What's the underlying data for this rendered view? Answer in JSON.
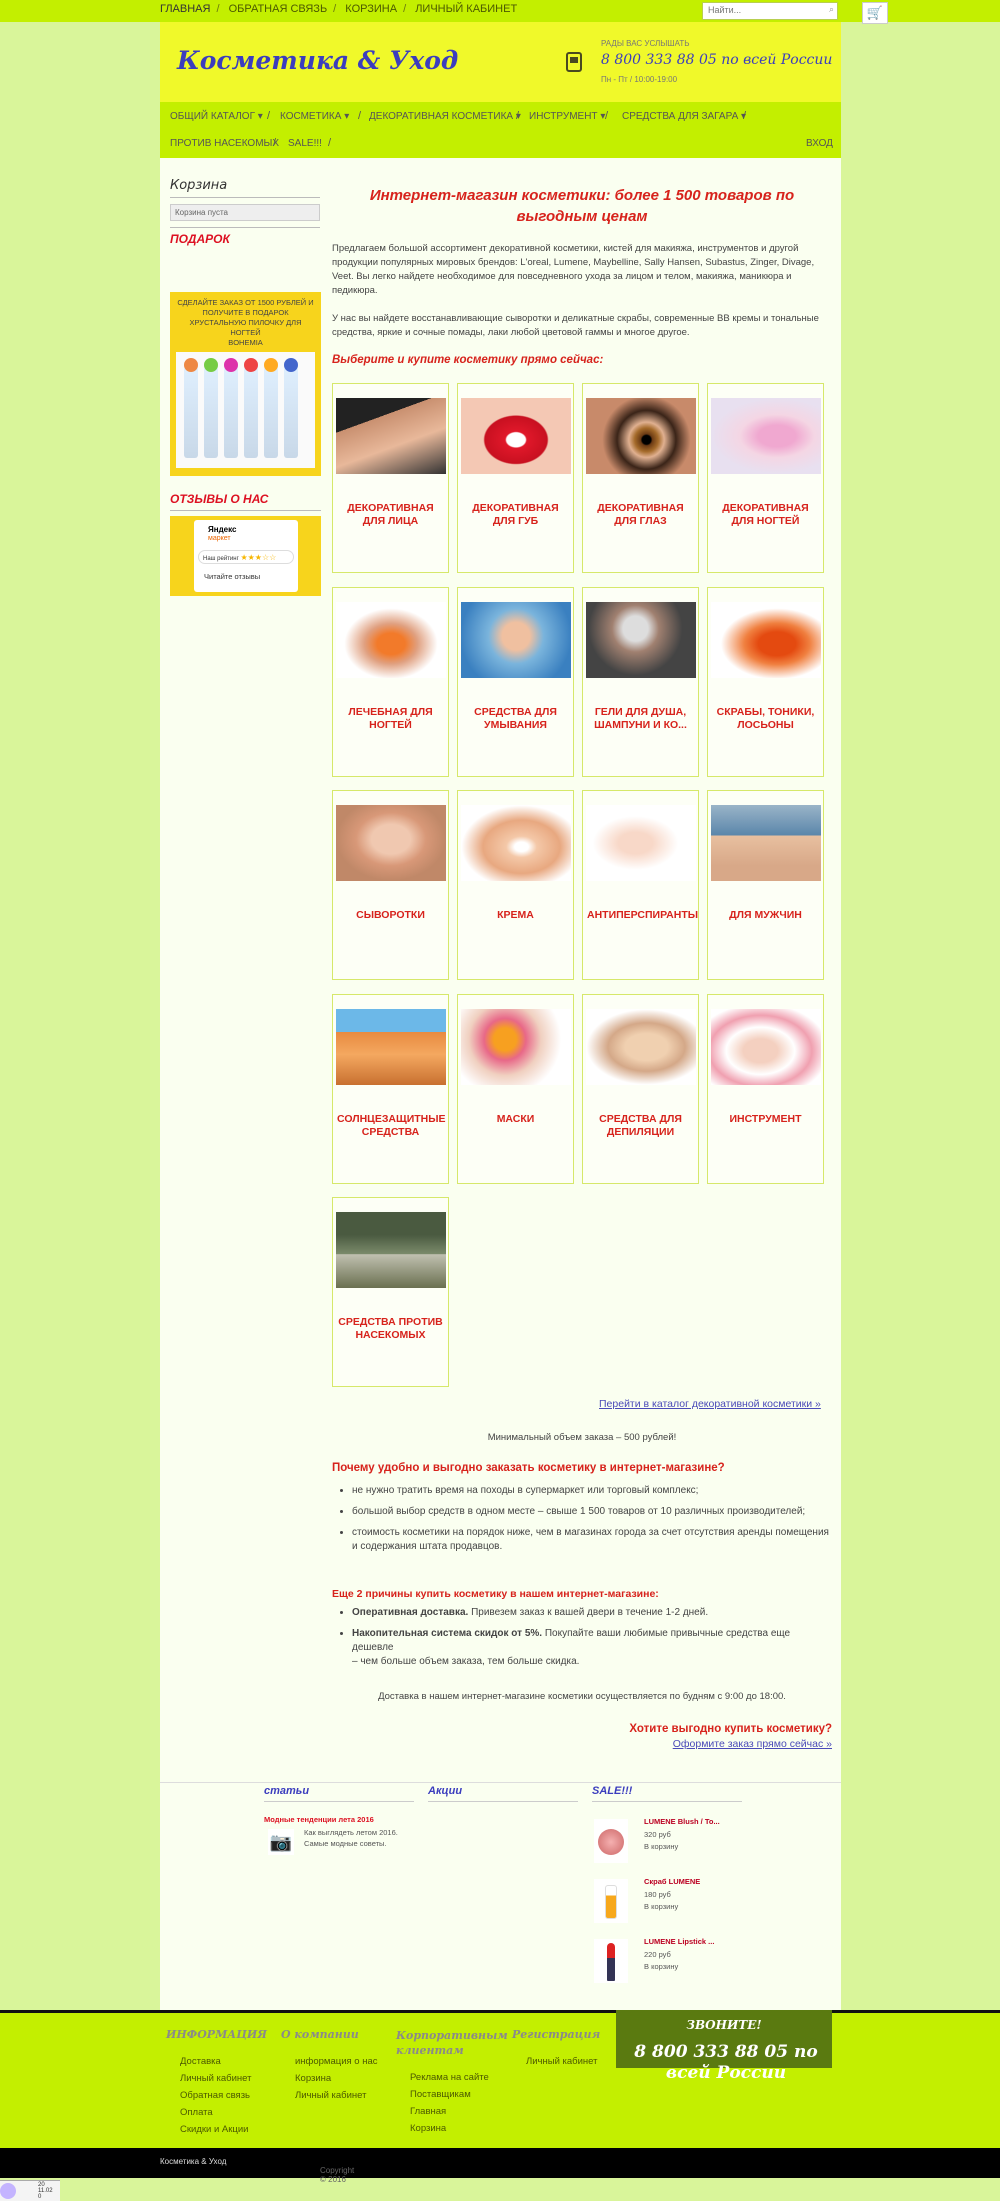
{
  "topnav": [
    "ГЛАВНАЯ",
    "ОБРАТНАЯ СВЯЗЬ",
    "КОРЗИНА",
    "ЛИЧНЫЙ КАБИНЕТ"
  ],
  "search": {
    "placeholder": "Найти..."
  },
  "header": {
    "logo": "Косметика & Уход",
    "small": "РАДЫ ВАС УСЛЫШАТЬ",
    "phone": "8 800 333 88 05 по всей России",
    "hours": "Пн - Пт / 10:00-19:00"
  },
  "menu": {
    "row1": [
      "ОБЩИЙ КАТАЛОГ",
      "КОСМЕТИКА",
      "ДЕКОРАТИВНАЯ КОСМЕТИКА",
      "ИНСТРУМЕНТ",
      "СРЕДСТВА ДЛЯ ЗАГАРА"
    ],
    "row2": [
      "ПРОТИВ НАСЕКОМЫХ",
      "SALE!!!"
    ],
    "login": "ВХОД"
  },
  "sidebar": {
    "cart_title": "Корзина",
    "cart_empty": "Корзина пуста",
    "gift_title": "ПОДАРОК",
    "gift_text": "СДЕЛАЙТЕ ЗАКАЗ ОТ 1500 РУБЛЕЙ И ПОЛУЧИТЕ В ПОДАРОК ХРУСТАЛЬНУЮ ПИЛОЧКУ ДЛЯ НОГТЕЙ",
    "gift_brand": "BOHEMIA",
    "reviews_title": "ОТЗЫВЫ О НАС",
    "yandex": "Яндекс",
    "market": "маркет",
    "our_rating": "Наш рейтинг",
    "read_reviews": "Читайте отзывы"
  },
  "main": {
    "title": "Интернет-магазин косметики: более 1 500 товаров по выгодным ценам",
    "p1": "Предлагаем большой ассортимент декоративной косметики, кистей для макияжа, инструментов и другой продукции популярных мировых брендов: L'oreal, Lumene, Maybelline, Sally Hansen, Subastus, Zinger, Divage, Veet. Вы легко найдете необходимое для повседневного ухода за лицом и телом, макияжа, маникюра и педикюра.",
    "p2": "У нас вы найдете восстанавливающие сыворотки и деликатные скрабы, современные ВВ кремы и тональные средства, яркие и сочные помады, лаки любой цветовой гаммы и многое другое.",
    "choose": "Выберите и купите косметику прямо сейчас:",
    "categories": [
      "ДЕКОРАТИВНАЯ ДЛЯ ЛИЦА",
      "ДЕКОРАТИВНАЯ ДЛЯ ГУБ",
      "ДЕКОРАТИВНАЯ ДЛЯ ГЛАЗ",
      "ДЕКОРАТИВНАЯ ДЛЯ НОГТЕЙ",
      "ЛЕЧЕБНАЯ ДЛЯ НОГТЕЙ",
      "СРЕДСТВА ДЛЯ УМЫВАНИЯ",
      "ГЕЛИ ДЛЯ ДУША, ШАМПУНИ И КО...",
      "СКРАБЫ, ТОНИКИ, ЛОСЬОНЫ",
      "СЫВОРОТКИ",
      "КРЕМА",
      "АНТИПЕРСПИРАНТЫ",
      "ДЛЯ МУЖЧИН",
      "СОЛНЦЕЗАЩИТНЫЕ СРЕДСТВА",
      "МАСКИ",
      "СРЕДСТВА ДЛЯ ДЕПИЛЯЦИИ",
      "ИНСТРУМЕНТ",
      "СРЕДСТВА ПРОТИВ НАСЕКОМЫХ"
    ],
    "catalog_link": "Перейти в каталог декоративной косметики »",
    "min_order": "Минимальный объем заказа – 500 рублей!",
    "why_title": "Почему удобно и выгодно заказать косметику в интернет-магазине?",
    "why": [
      "не нужно тратить время на походы в супермаркет или торговый комплекс;",
      "большой выбор средств в одном месте – свыше 1 500 товаров от 10 различных производителей;",
      "стоимость косметики на порядок ниже, чем в магазинах города за счет отсутствия аренды помещения и содержания штата продавцов."
    ],
    "reasons_title": "Еще 2 причины купить косметику в нашем интернет-магазине:",
    "reason1_bold": "Оперативная доставка.",
    "reason1_rest": " Привезем заказ к вашей двери в течение 1-2 дней.",
    "reason2_bold": "Накопительная система скидок от 5%.",
    "reason2_rest": " Покупайте ваши любимые привычные средства еще дешевле",
    "reason2_line2": "– чем больше объем заказа, тем больше скидка.",
    "delivery": "Доставка в нашем интернет-магазине косметики осуществляется по будням с 9:00 до 18:00.",
    "cta": "Хотите выгодно купить косметику?",
    "cta_link": "Оформите заказ прямо сейчас »"
  },
  "widgets": {
    "articles_title": "статьи",
    "article_title": "Модные тенденции лета 2016",
    "article_text": "Как выглядеть летом 2016. Самые модные советы.",
    "news_title": "Акции",
    "sale_title": "SALE!!!",
    "products": [
      {
        "name": "LUMENE Blush / To...",
        "price": "320 руб",
        "cart": "В корзину"
      },
      {
        "name": "Скраб LUMENE",
        "price": "180 руб",
        "cart": "В корзину"
      },
      {
        "name": "LUMENE Lipstick ...",
        "price": "220 руб",
        "cart": "В корзину"
      }
    ]
  },
  "footer": {
    "cols": [
      {
        "title": "ИНФОРМАЦИЯ",
        "links": [
          "Доставка",
          "Личный кабинет",
          "Обратная связь",
          "Оплата",
          "Скидки и Акции"
        ]
      },
      {
        "title": "О компании",
        "links": [
          "информация о нас",
          "Корзина",
          "Личный кабинет"
        ]
      },
      {
        "title": "Корпоративным клиентам",
        "links": [
          "Реклама на сайте",
          "Поставщикам",
          "Главная",
          "Корзина"
        ]
      },
      {
        "title": "Регистрация",
        "links": [
          "Личный кабинет"
        ]
      }
    ],
    "call_title": "ЗВОНИТЕ!",
    "call_phone": "8 800 333 88 05 по всей России",
    "copyright_prefix": "Copyright © 2016",
    "copyright_name": "Косметика & Уход"
  },
  "clock": {
    "line1": "20",
    "line2": "11.02",
    "line3": "0"
  },
  "colors": {
    "accent": "#c3ef00",
    "header": "#f0f92a",
    "title_red": "#d7231c",
    "logo_blue": "#3b3dbe"
  }
}
